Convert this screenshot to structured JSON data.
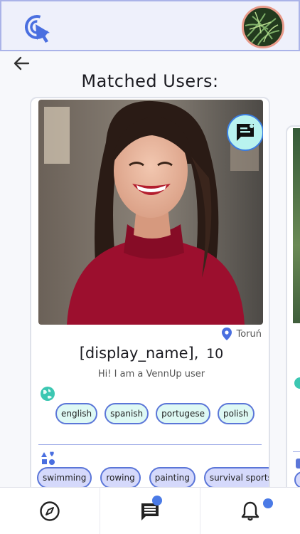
{
  "header": {
    "logo_icon": "cursor-target-icon",
    "avatar_icon": "profile-avatar"
  },
  "nav": {
    "back_icon": "arrow-left-icon"
  },
  "page": {
    "title": "Matched Users:"
  },
  "match_card": {
    "message_icon": "message-icon",
    "location_icon": "map-pin-icon",
    "location": "Toruń",
    "display_name": "[display_name],",
    "age": "10",
    "bio": "Hi! I am a VennUp user",
    "languages_icon": "globe-icon",
    "languages": [
      "english",
      "spanish",
      "portugese",
      "polish"
    ],
    "hobbies_icon": "shapes-icon",
    "hobbies": [
      "swimming",
      "rowing",
      "painting",
      "survival sports"
    ]
  },
  "bottom_nav": {
    "items": [
      {
        "icon": "compass-icon",
        "badge": false
      },
      {
        "icon": "chat-icon",
        "badge": true
      },
      {
        "icon": "bell-icon",
        "badge": true
      }
    ]
  },
  "colors": {
    "accent": "#4a6fe0",
    "chip_language_bg": "#def9f4",
    "chip_hobby_bg": "#d5d9fb",
    "badge": "#4a7ae6",
    "globe": "#3cc7b2"
  }
}
